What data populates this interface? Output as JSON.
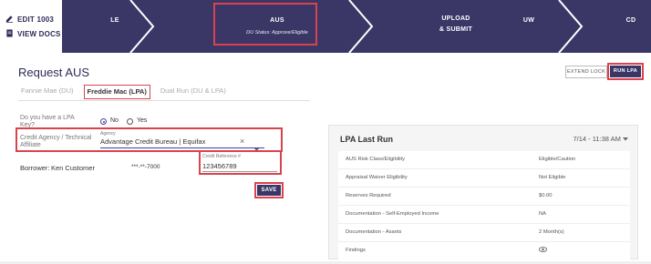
{
  "top_left": {
    "edit_label": "EDIT 1003",
    "view_docs_label": "VIEW DOCS"
  },
  "stepper": {
    "steps": [
      {
        "label": "LE"
      },
      {
        "label": "AUS",
        "sub": "DU Status: Approve/Eligible"
      },
      {
        "label": "UPLOAD",
        "label2": "& SUBMIT"
      },
      {
        "label": "UW"
      },
      {
        "label": "CD"
      }
    ]
  },
  "header": {
    "title": "Request AUS",
    "extend_lock_label": "EXTEND LOCK",
    "run_lpa_label": "RUN LPA"
  },
  "tabs": [
    {
      "label": "Fannie Mae (DU)"
    },
    {
      "label": "Freddie Mac (LPA)"
    },
    {
      "label": "Dual Run (DU & LPA)"
    }
  ],
  "form": {
    "lpa_key_question": "Do you have a LPA Key?",
    "option_no": "No",
    "option_yes": "Yes",
    "credit_label": "Credit Agency / Technical Affiliate",
    "agency_caption": "Agency",
    "agency_value": "Advantage Credit Bureau | Equifax",
    "clear_symbol": "×",
    "borrower_label": "Borrower:",
    "borrower_name": "Ken Customer",
    "ssn_masked": "***-**-7000",
    "credit_ref_caption": "Credit Reference #",
    "credit_ref_value": "123456789",
    "save_label": "SAVE"
  },
  "lpa_card": {
    "title": "LPA Last Run",
    "date": "7/14 - 11:38 AM",
    "rows": [
      {
        "label": "AUS Risk Class/Eligibility",
        "value": "Eligible/Caution"
      },
      {
        "label": "Appraisal Waiver Eligibility",
        "value": "Not Eligible"
      },
      {
        "label": "Reserves Required",
        "value": "$0.00"
      },
      {
        "label": "Documentation - Self-Employed Income",
        "value": "NA"
      },
      {
        "label": "Documentation - Assets",
        "value": "2 Month(s)"
      },
      {
        "label": "Findings",
        "value": ""
      }
    ]
  },
  "colors": {
    "stepper_bg": "#3a3767",
    "highlight": "#d9434e",
    "accent": "#4a3f9a"
  }
}
